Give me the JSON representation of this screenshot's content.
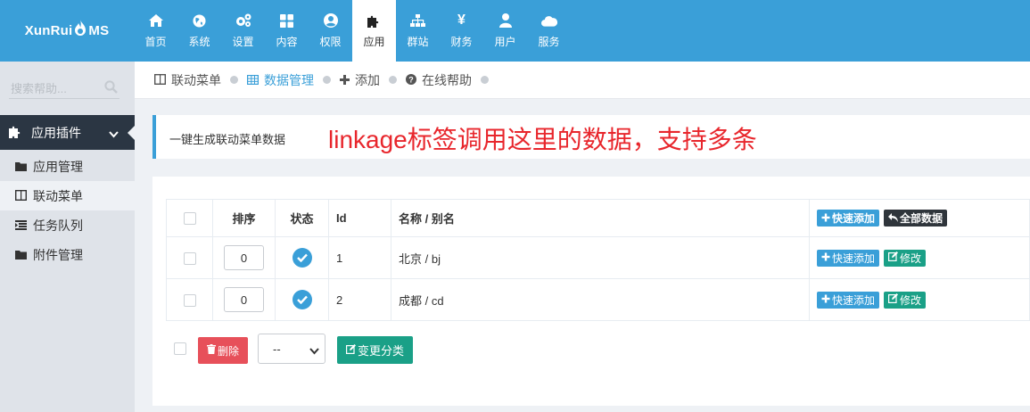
{
  "logo": {
    "text_left": "XunRui",
    "text_right": "MS"
  },
  "nav": [
    {
      "label": "首页",
      "icon": "home-icon"
    },
    {
      "label": "系统",
      "icon": "globe-icon"
    },
    {
      "label": "设置",
      "icon": "cogs-icon"
    },
    {
      "label": "内容",
      "icon": "grid-icon"
    },
    {
      "label": "权限",
      "icon": "user-circle-icon"
    },
    {
      "label": "应用",
      "icon": "puzzle-icon",
      "active": true
    },
    {
      "label": "群站",
      "icon": "sitemap-icon"
    },
    {
      "label": "财务",
      "icon": "yen-icon"
    },
    {
      "label": "用户",
      "icon": "user-icon"
    },
    {
      "label": "服务",
      "icon": "cloud-icon"
    }
  ],
  "sidebar": {
    "search_placeholder": "搜索帮助...",
    "section": "应用插件",
    "items": [
      {
        "label": "应用管理",
        "icon": "folder-icon"
      },
      {
        "label": "联动菜单",
        "icon": "columns-icon",
        "active": true
      },
      {
        "label": "任务队列",
        "icon": "list-indent-icon"
      },
      {
        "label": "附件管理",
        "icon": "folder-icon"
      }
    ]
  },
  "breadcrumb": [
    {
      "label": "联动菜单",
      "icon": "columns-icon"
    },
    {
      "label": "数据管理",
      "icon": "table-icon",
      "active": true
    },
    {
      "label": "添加",
      "icon": "plus-icon"
    },
    {
      "label": "在线帮助",
      "icon": "question-circle-icon"
    }
  ],
  "note": {
    "text": "一键生成联动菜单数据",
    "annotation": "linkage标签调用这里的数据，支持多条"
  },
  "table": {
    "headers": {
      "order": "排序",
      "status": "状态",
      "id": "Id",
      "name": "名称 / 别名"
    },
    "header_actions": {
      "quick_add": "快速添加",
      "all_data": "全部数据"
    },
    "rows": [
      {
        "order": "0",
        "id": "1",
        "name": "北京 / bj",
        "quick_add": "快速添加",
        "edit": "修改"
      },
      {
        "order": "0",
        "id": "2",
        "name": "成都 / cd",
        "quick_add": "快速添加",
        "edit": "修改"
      }
    ]
  },
  "footer": {
    "delete_label": "删除",
    "select_value": "--",
    "change_label": "变更分类"
  },
  "colors": {
    "primary": "#3a9fd8",
    "dark": "#2b3643",
    "green": "#1aa087",
    "red": "#e7505a",
    "annotation": "#e8262c"
  }
}
